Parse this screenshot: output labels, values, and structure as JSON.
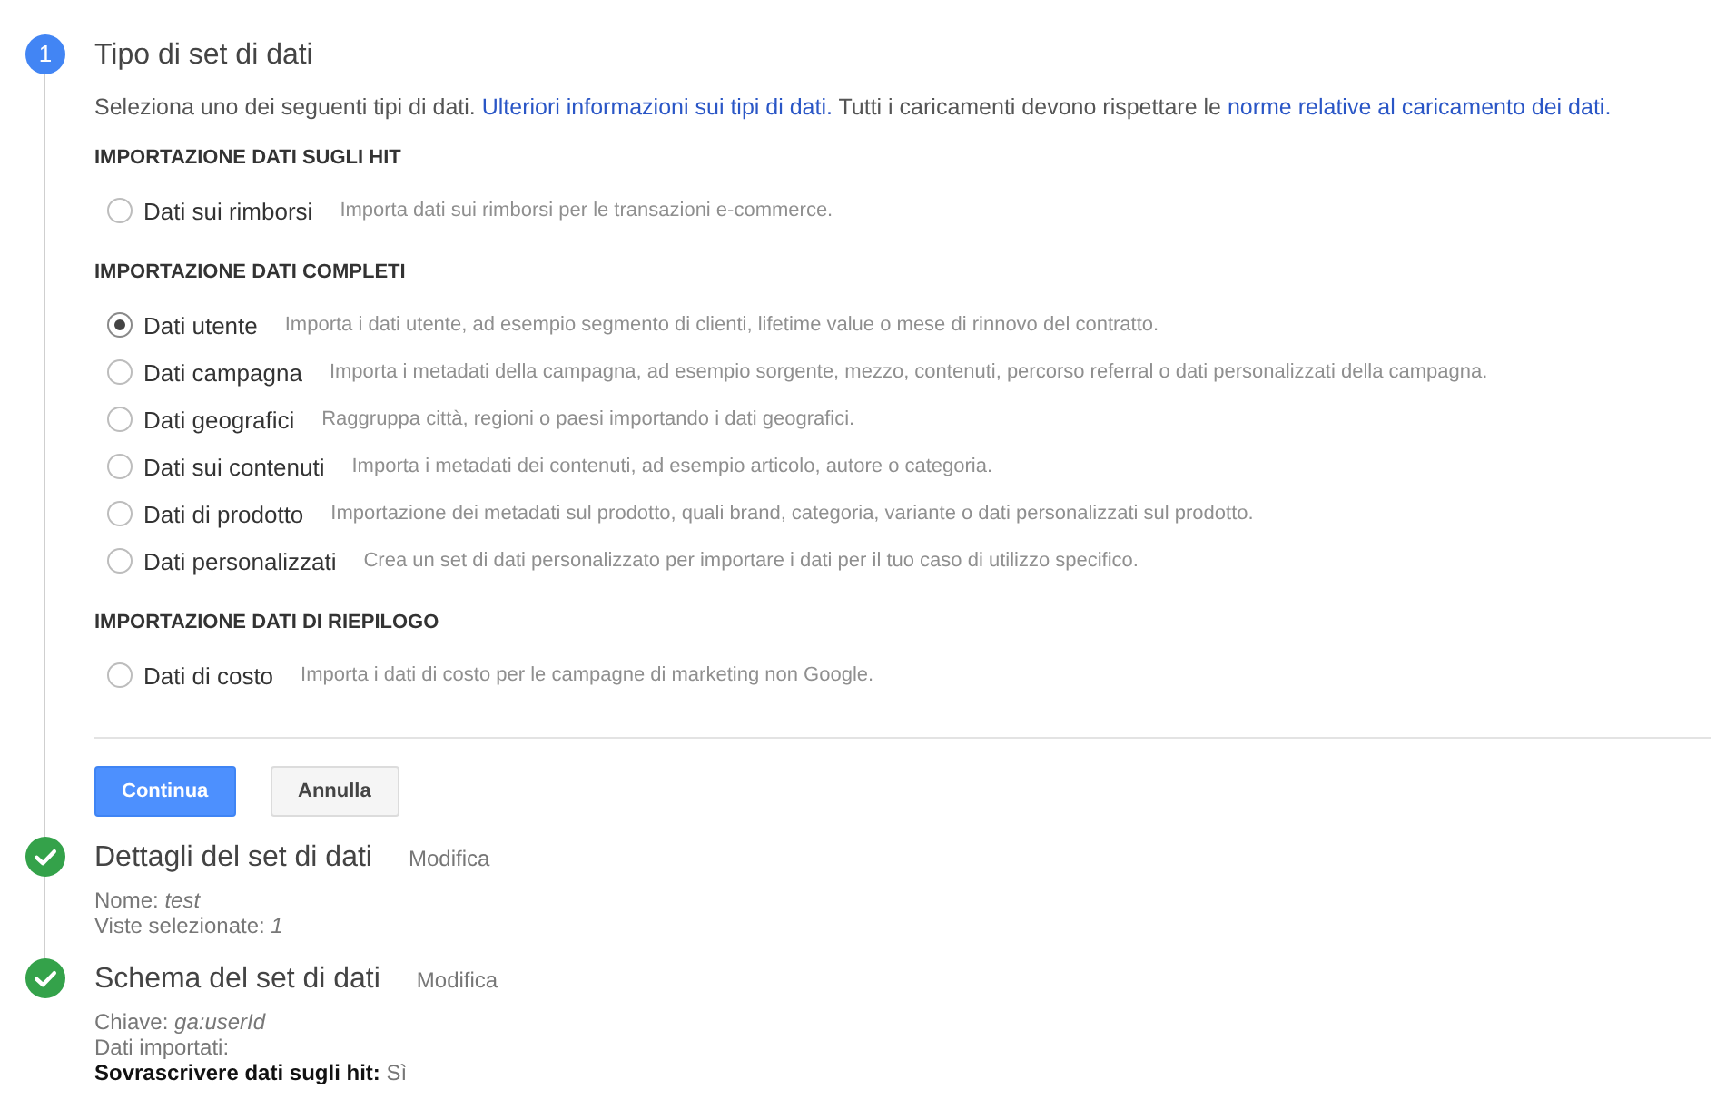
{
  "steps": [
    {
      "kind": "current",
      "badge": "1",
      "title": "Tipo di set di dati",
      "intro": [
        {
          "kind": "text",
          "text": "Seleziona uno dei seguenti tipi di dati. "
        },
        {
          "kind": "link",
          "text": "Ulteriori informazioni sui tipi di dati."
        },
        {
          "kind": "text",
          "text": " Tutti i caricamenti devono rispettare le "
        },
        {
          "kind": "link",
          "text": "norme relative al caricamento dei dati."
        }
      ],
      "sections": [
        {
          "heading": "IMPORTAZIONE DATI SUGLI HIT",
          "options": [
            {
              "label": "Dati sui rimborsi",
              "description": "Importa dati sui rimborsi per le transazioni e-commerce.",
              "selected": false
            }
          ]
        },
        {
          "heading": "IMPORTAZIONE DATI COMPLETI",
          "options": [
            {
              "label": "Dati utente",
              "description": "Importa i dati utente, ad esempio segmento di clienti, lifetime value o mese di rinnovo del contratto.",
              "selected": true
            },
            {
              "label": "Dati campagna",
              "description": "Importa i metadati della campagna, ad esempio sorgente, mezzo, contenuti, percorso referral o dati personalizzati della campagna.",
              "selected": false
            },
            {
              "label": "Dati geografici",
              "description": "Raggruppa città, regioni o paesi importando i dati geografici.",
              "selected": false
            },
            {
              "label": "Dati sui contenuti",
              "description": "Importa i metadati dei contenuti, ad esempio articolo, autore o categoria.",
              "selected": false
            },
            {
              "label": "Dati di prodotto",
              "description": "Importazione dei metadati sul prodotto, quali brand, categoria, variante o dati personalizzati sul prodotto.",
              "selected": false
            },
            {
              "label": "Dati personalizzati",
              "description": "Crea un set di dati personalizzato per importare i dati per il tuo caso di utilizzo specifico.",
              "selected": false
            }
          ]
        },
        {
          "heading": "IMPORTAZIONE DATI DI RIEPILOGO",
          "options": [
            {
              "label": "Dati di costo",
              "description": "Importa i dati di costo per le campagne di marketing non Google.",
              "selected": false
            }
          ]
        }
      ],
      "buttons": [
        {
          "kind": "primary",
          "label": "Continua"
        },
        {
          "kind": "secondary",
          "label": "Annulla"
        }
      ]
    },
    {
      "kind": "done",
      "title": "Dettagli del set di dati",
      "action": "Modifica",
      "details": [
        "Nome: *test*",
        "Viste selezionate: *1*"
      ]
    },
    {
      "kind": "done",
      "title": "Schema del set di dati",
      "action": "Modifica",
      "details": [
        "Chiave: *ga:userId*",
        "Dati importati:",
        "**Sovrascrivere dati sugli hit:** Sì"
      ]
    }
  ]
}
